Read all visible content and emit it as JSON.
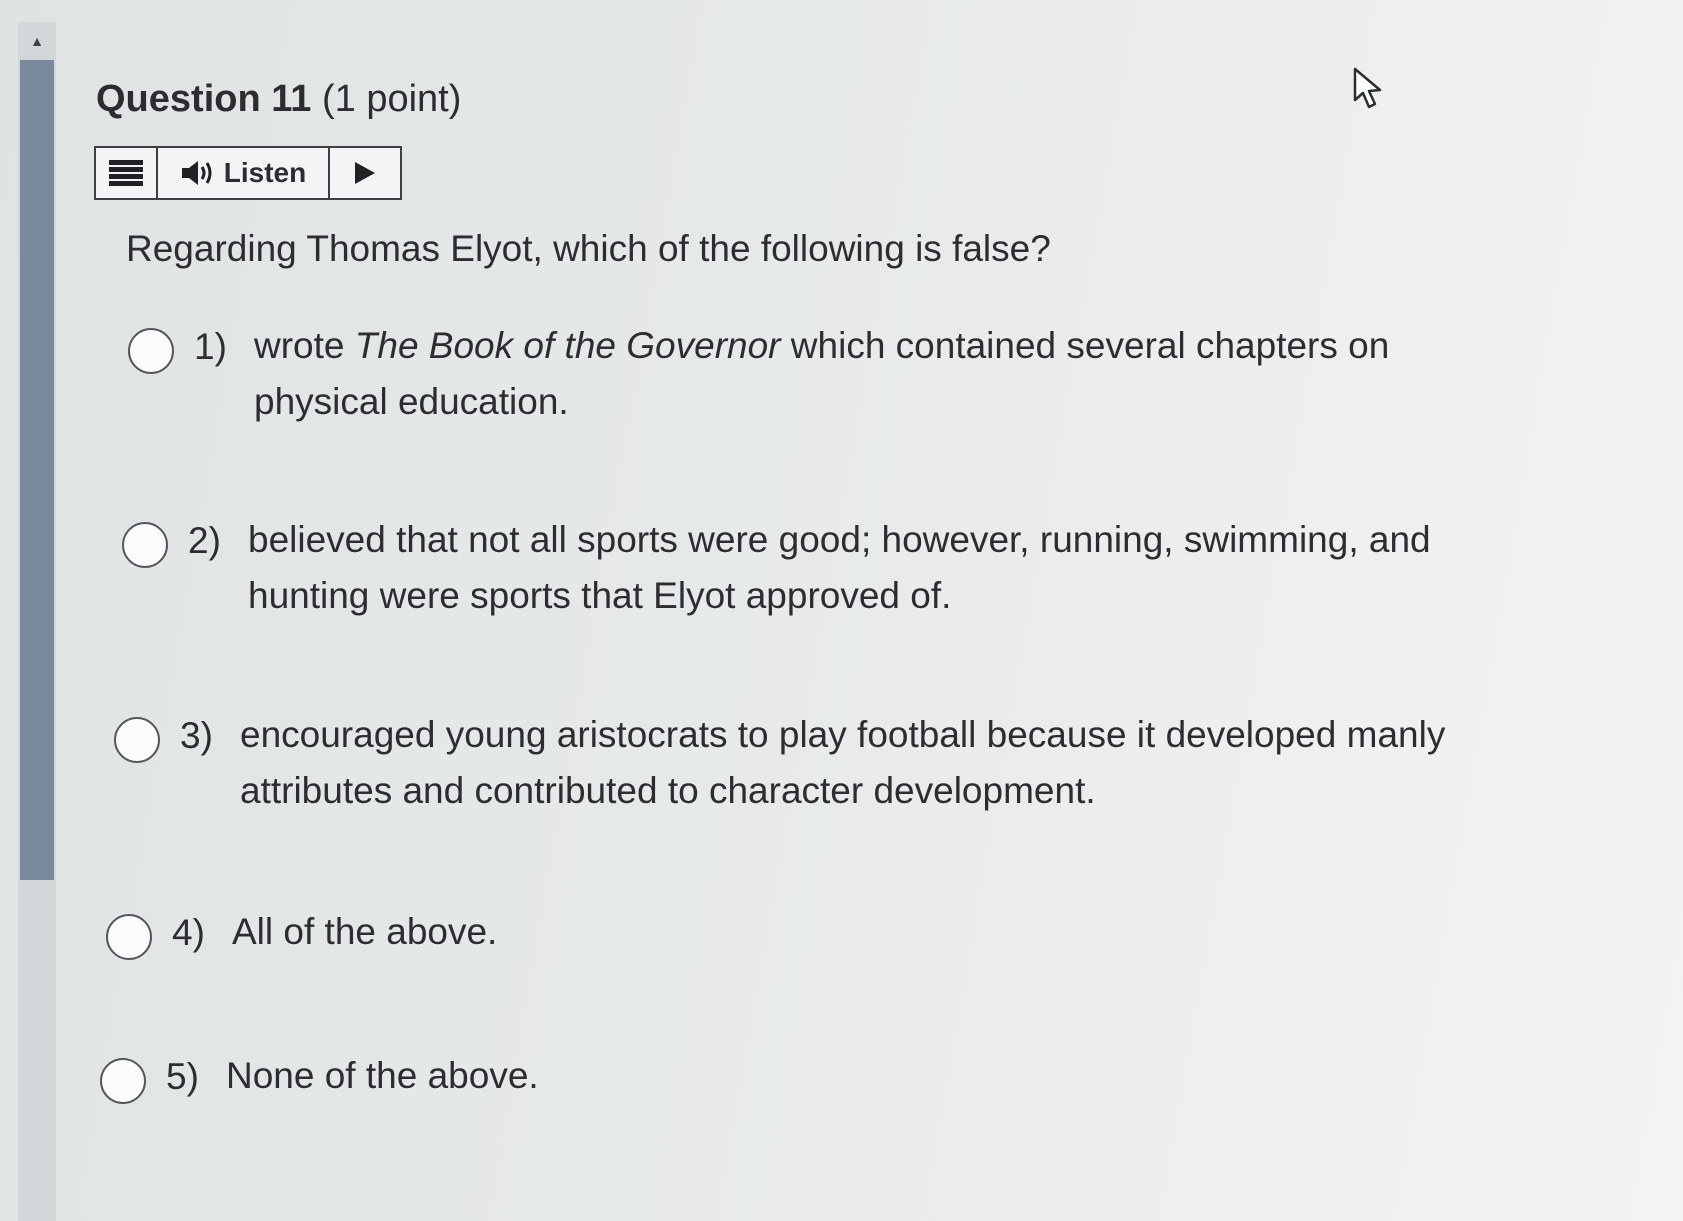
{
  "question": {
    "number_label": "Question 11",
    "points_label": "(1 point)"
  },
  "listen_bar": {
    "menu_icon": "menu-icon",
    "speaker_icon": "speaker-icon",
    "listen_label": "Listen",
    "play_icon": "play-icon"
  },
  "prompt": "Regarding Thomas Elyot, which of the following is false?",
  "options": [
    {
      "number": "1)",
      "text_before": "wrote ",
      "italic": "The Book of the Governor",
      "text_after": " which contained several chapters on physical education.",
      "selected": false
    },
    {
      "number": "2)",
      "text": "believed that not all sports were good; however, running, swimming, and hunting were sports that Elyot approved of.",
      "selected": false
    },
    {
      "number": "3)",
      "text": "encouraged young aristocrats to play football because it developed manly attributes and contributed to character development.",
      "selected": false
    },
    {
      "number": "4)",
      "text": "All of the above.",
      "selected": false
    },
    {
      "number": "5)",
      "text": "None of the above.",
      "selected": false
    }
  ],
  "colors": {
    "scroll_thumb": "#7a8a9c",
    "text": "#2b2d30"
  }
}
